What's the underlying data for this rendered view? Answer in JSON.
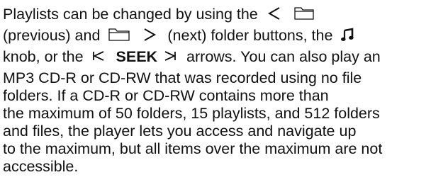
{
  "paragraph": {
    "line1": "Playlists can be changed by using the",
    "line2_a": "(previous) and",
    "line2_b": "(next) folder buttons, the",
    "line3_a": "knob, or the",
    "line3_seek": "SEEK",
    "line3_b": "arrows. You can also play an",
    "line4": "MP3 CD-R or CD-RW that was recorded using no file",
    "line5": "folders. If a CD-R or CD-RW contains more than",
    "line6": "the maximum of 50 folders, 15 playlists, and 512 folders",
    "line7": "and files, the player lets you access and navigate up",
    "line8": "to the maximum, but all items over the maximum are not",
    "line9": "accessible."
  },
  "icons": {
    "previous_arrow": "less-than-icon",
    "folder": "folder-icon",
    "next_arrow": "greater-than-icon",
    "music_note": "music-note-icon",
    "seek_left": "seek-left-icon",
    "seek_right": "seek-right-icon"
  }
}
